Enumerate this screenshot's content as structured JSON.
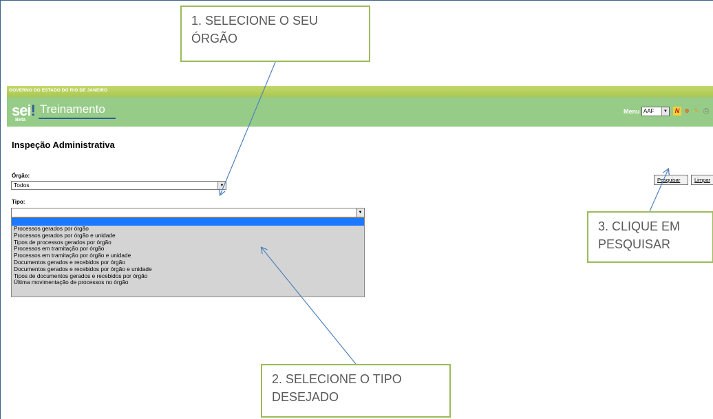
{
  "header": {
    "government": "GOVERNO DO ESTADO DO RIO DE JANEIRO",
    "logo_text": "sei",
    "logo_mark": "!",
    "logo_badge": "Beta",
    "system_name": "Treinamento",
    "menu_label": "Menu",
    "unit_selected": "AAF",
    "icons": [
      "nova-icon",
      "user-icon",
      "tools-icon",
      "print-icon"
    ]
  },
  "page": {
    "title": "Inspeção Administrativa",
    "orgao_label": "Órgão:",
    "orgao_value": "Todos",
    "tipo_label": "Tipo:",
    "tipo_value": "",
    "tipo_options": [
      "",
      "Processos gerados por órgão",
      "Processos gerados por órgão e unidade",
      "Tipos de processos gerados por órgão",
      "Processos em tramitação por órgão",
      "Processos em tramitação por órgão e unidade",
      "Documentos gerados e recebidos por órgão",
      "Documentos gerados e recebidos por órgão e unidade",
      "Tipos de documentos gerados e recebidos por órgão",
      "Última movimentação de processos no órgão"
    ],
    "search_button": "Pesquisar",
    "clear_button": "Limpar"
  },
  "callouts": {
    "step1_line1": "1. SELECIONE O SEU",
    "step1_line2": "ÓRGÃO",
    "step2_line1": "2. SELECIONE O TIPO",
    "step2_line2": "DESEJADO",
    "step3_line1": "3. CLIQUE EM",
    "step3_line2": "PESQUISAR"
  },
  "colors": {
    "gov_bar": "#aac852",
    "header_green": "#96cc88",
    "logo_blue": "#2a5d96",
    "dropdown_highlight": "#1b79ff",
    "callout_border": "#9bbb59",
    "arrow": "#4f81bd"
  }
}
